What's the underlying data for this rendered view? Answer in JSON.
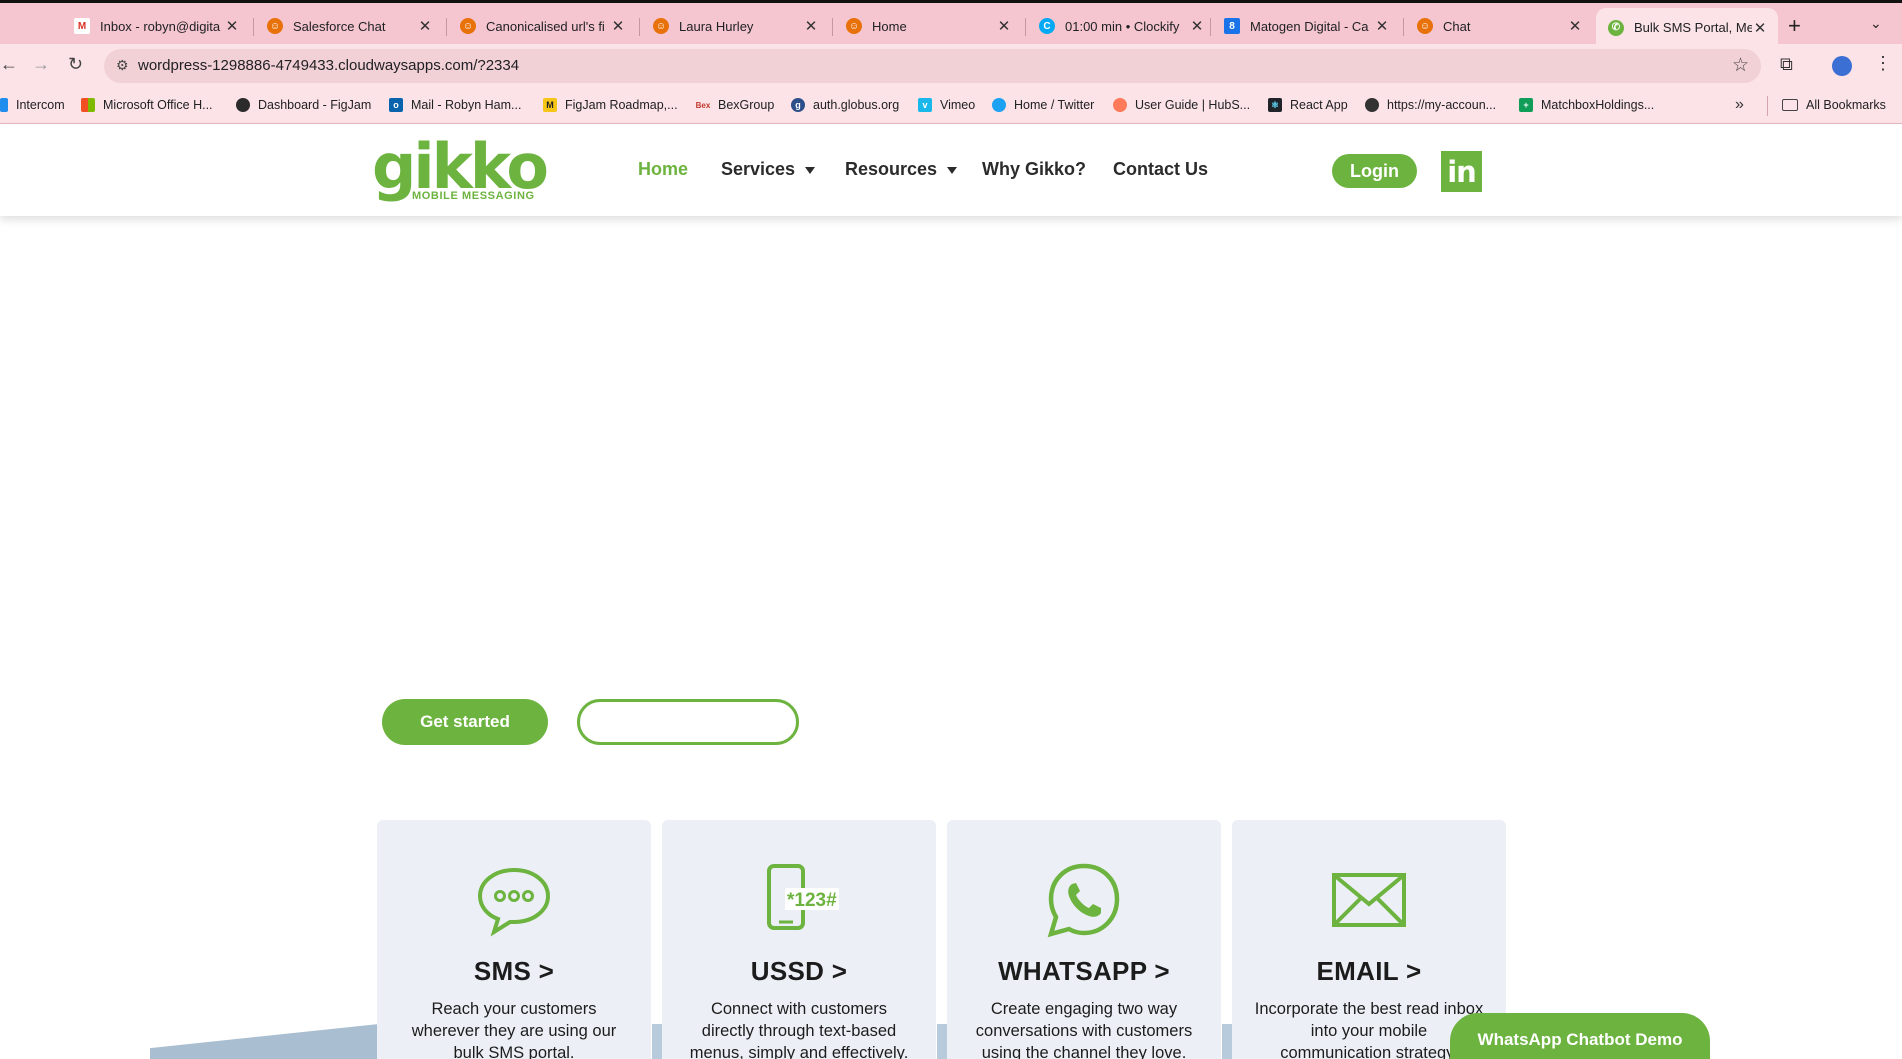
{
  "browser": {
    "tabs": [
      {
        "title": "Inbox - robyn@digita",
        "favicon": "gmail-icon",
        "color": "#d93025",
        "active": false
      },
      {
        "title": "Salesforce Chat",
        "favicon": "chat-smiley-icon",
        "color": "#e8710a",
        "active": false
      },
      {
        "title": "Canonicalised url's fi",
        "favicon": "chat-smiley-icon",
        "color": "#e8710a",
        "active": false
      },
      {
        "title": "Laura Hurley",
        "favicon": "chat-smiley-icon",
        "color": "#e8710a",
        "active": false
      },
      {
        "title": "Home",
        "favicon": "chat-smiley-icon",
        "color": "#e8710a",
        "active": false
      },
      {
        "title": "01:00 min • Clockify",
        "favicon": "clockify-icon",
        "color": "#03a9f4",
        "active": false
      },
      {
        "title": "Matogen Digital - Ca",
        "favicon": "calendar-icon",
        "color": "#1a73e8",
        "active": false
      },
      {
        "title": "Chat",
        "favicon": "chat-smiley-icon",
        "color": "#e8710a",
        "active": false
      },
      {
        "title": "Bulk SMS Portal, Me",
        "favicon": "whatsapp-icon",
        "color": "#6db33f",
        "active": true
      }
    ],
    "url": "wordpress-1298886-4749433.cloudwaysapps.com/?2334",
    "bookmarks": [
      {
        "label": "Intercom",
        "color": "#1f8ded"
      },
      {
        "label": "Microsoft Office H...",
        "color": "#f25022"
      },
      {
        "label": "Dashboard - FigJam",
        "color": "#2b2b2b"
      },
      {
        "label": "Mail - Robyn Ham...",
        "color": "#0a64ad"
      },
      {
        "label": "FigJam Roadmap,...",
        "color": "#f5c518"
      },
      {
        "label": "BexGroup",
        "color": "#c0392b"
      },
      {
        "label": "auth.globus.org",
        "color": "#2c4f8a"
      },
      {
        "label": "Vimeo",
        "color": "#1ab7ea"
      },
      {
        "label": "Home / Twitter",
        "color": "#1da1f2"
      },
      {
        "label": "User Guide | HubS...",
        "color": "#ff7a59"
      },
      {
        "label": "React App",
        "color": "#20232a"
      },
      {
        "label": "https://my-accoun...",
        "color": "#333333"
      },
      {
        "label": "MatchboxHoldings...",
        "color": "#0f9d58"
      }
    ],
    "all_bookmarks": "All Bookmarks"
  },
  "site": {
    "brand_color": "#6db33f",
    "logo": {
      "word": "gikko",
      "tagline": "MOBILE MESSAGING"
    },
    "nav": {
      "home": "Home",
      "services": "Services",
      "resources": "Resources",
      "why": "Why Gikko?",
      "contact": "Contact Us"
    },
    "login": "Login",
    "linkedin": "in",
    "hero": {
      "get_started": "Get started",
      "secondary": ""
    },
    "cards": [
      {
        "title": "SMS >",
        "icon": "sms-bubble-icon",
        "desc": "Reach your customers wherever they are using our bulk SMS portal."
      },
      {
        "title": "USSD >",
        "icon": "ussd-phone-icon",
        "desc": "Connect with customers directly through text-based menus, simply and effectively."
      },
      {
        "title": "WHATSAPP >",
        "icon": "whatsapp-icon",
        "desc": "Create engaging two way conversations with customers using the channel they love."
      },
      {
        "title": "EMAIL >",
        "icon": "envelope-icon",
        "desc": "Incorporate the best read inbox into your mobile communication strategy."
      }
    ],
    "ussd_icon_text": "*123#",
    "whatsapp_demo": "WhatsApp Chatbot Demo"
  }
}
